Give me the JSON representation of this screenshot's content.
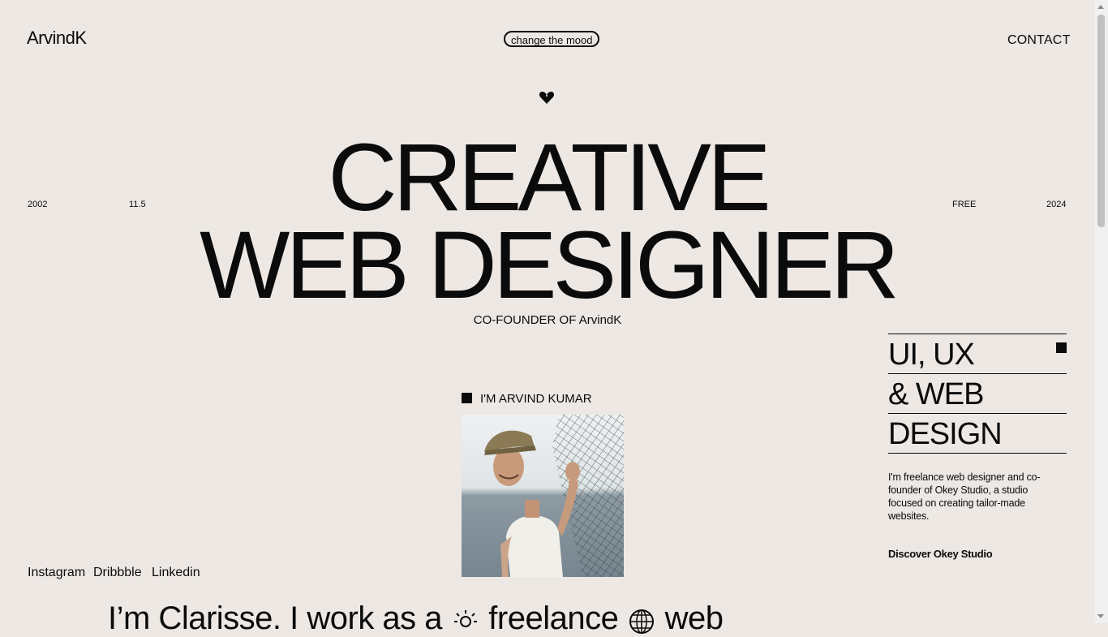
{
  "header": {
    "logo": "ArvindK",
    "mood_button": "change the mood",
    "contact": "CONTACT"
  },
  "hero": {
    "meta_left_1": "2002",
    "meta_left_2": "11.5",
    "meta_right_1": "FREE",
    "meta_right_2": "2024",
    "headline_line1": "CREATIVE",
    "headline_line2": "WEB DESIGNER",
    "subtitle": "CO-FOUNDER OF ArvindK"
  },
  "services": {
    "lines": [
      "UI, UX",
      "& WEB",
      "DESIGN"
    ],
    "bio": "I'm freelance web designer and co-founder of Okey Studio, a studio focused on creating tailor-made websites.",
    "discover": "Discover Okey Studio"
  },
  "profile": {
    "label": "I'M ARVIND KUMAR"
  },
  "social": [
    "Instagram",
    "Dribbble",
    "Linkedin"
  ],
  "intro": {
    "part1": "I’m Clarisse. I work as a",
    "part2": "freelance",
    "part3": "web"
  },
  "icons": {
    "heart": "heart-icon",
    "sun": "sun-icon",
    "globe": "globe-icon"
  },
  "colors": {
    "background": "#ede8e4",
    "ink": "#0b0b0b"
  }
}
